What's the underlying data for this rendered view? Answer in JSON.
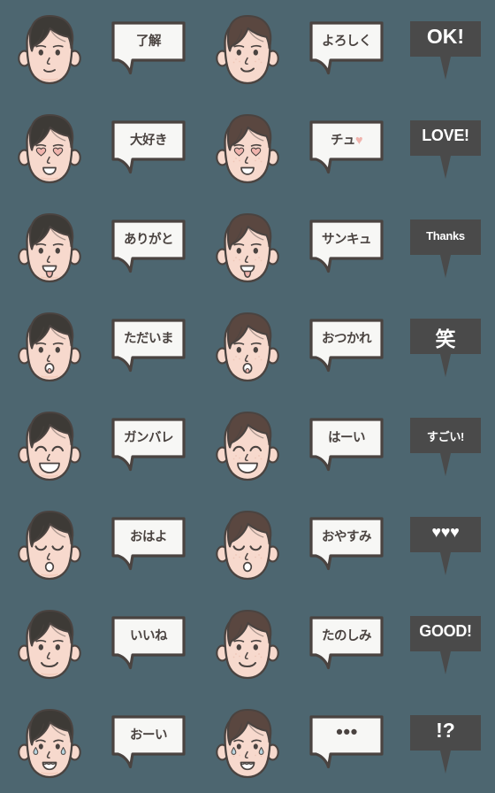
{
  "sheet": {
    "title": "Emoji sticker sheet",
    "background_color": "#4d6670",
    "columns": 5,
    "rows": 8,
    "colors": {
      "background": "#4d6670",
      "bubble_white_fill": "#f7f7f5",
      "bubble_white_border": "#4a4340",
      "bubble_dark_fill": "#4a4a4a",
      "bubble_text_dark": "#4a4340",
      "bubble_text_light": "#ffffff",
      "hair_dark": "#3d3a36",
      "hair_brown": "#5a4740",
      "skin": "#f7d9cd",
      "skin_shadow": "#efc6b6",
      "outline": "#4a4340",
      "heart_pink": "#f0b4ad",
      "heart_white": "#ffffff",
      "tear": "#b8d4de"
    }
  },
  "items": [
    {
      "col": 1,
      "row": 1,
      "kind": "face",
      "name": "face-neutral-smile-dark-hair",
      "hair": "dark",
      "expression": "neutral-smile"
    },
    {
      "col": 2,
      "row": 1,
      "kind": "bubble-white",
      "name": "bubble-ryoukai",
      "text": "了解",
      "size": "jp"
    },
    {
      "col": 3,
      "row": 1,
      "kind": "face",
      "name": "face-smile-brown-hair",
      "hair": "brown",
      "expression": "smile"
    },
    {
      "col": 4,
      "row": 1,
      "kind": "bubble-white",
      "name": "bubble-yoroshiku",
      "text": "よろしく",
      "size": "jp"
    },
    {
      "col": 5,
      "row": 1,
      "kind": "bubble-dark",
      "name": "bubble-ok",
      "text": "OK!",
      "size": "big"
    },
    {
      "col": 1,
      "row": 2,
      "kind": "face",
      "name": "face-heart-eyes-dark-hair",
      "hair": "dark",
      "expression": "heart-eyes"
    },
    {
      "col": 2,
      "row": 2,
      "kind": "bubble-white",
      "name": "bubble-daisuki",
      "text": "大好き",
      "size": "jp"
    },
    {
      "col": 3,
      "row": 2,
      "kind": "face",
      "name": "face-heart-eyes-brown-hair",
      "hair": "brown",
      "expression": "heart-eyes"
    },
    {
      "col": 4,
      "row": 2,
      "kind": "bubble-white",
      "name": "bubble-chu-heart",
      "text": "チュ♡",
      "size": "jp",
      "heart_suffix": true
    },
    {
      "col": 5,
      "row": 2,
      "kind": "bubble-dark",
      "name": "bubble-love",
      "text": "LOVE!",
      "size": "med"
    },
    {
      "col": 1,
      "row": 3,
      "kind": "face",
      "name": "face-tongue-out-dark-hair",
      "hair": "dark",
      "expression": "tongue-out"
    },
    {
      "col": 2,
      "row": 3,
      "kind": "bubble-white",
      "name": "bubble-arigato",
      "text": "ありがと",
      "size": "jp"
    },
    {
      "col": 3,
      "row": 3,
      "kind": "face",
      "name": "face-tongue-out-brown-hair",
      "hair": "brown",
      "expression": "tongue-out"
    },
    {
      "col": 4,
      "row": 3,
      "kind": "bubble-white",
      "name": "bubble-sankyu",
      "text": "サンキュ",
      "size": "jp"
    },
    {
      "col": 5,
      "row": 3,
      "kind": "bubble-dark",
      "name": "bubble-thanks",
      "text": "Thanks",
      "size": "small"
    },
    {
      "col": 1,
      "row": 4,
      "kind": "face",
      "name": "face-whistle-dark-hair",
      "hair": "dark",
      "expression": "whistle"
    },
    {
      "col": 2,
      "row": 4,
      "kind": "bubble-white",
      "name": "bubble-tadaima",
      "text": "ただいま",
      "size": "jp"
    },
    {
      "col": 3,
      "row": 4,
      "kind": "face",
      "name": "face-whistle-brown-hair",
      "hair": "brown",
      "expression": "whistle"
    },
    {
      "col": 4,
      "row": 4,
      "kind": "bubble-white",
      "name": "bubble-otsukare",
      "text": "おつかれ",
      "size": "jp"
    },
    {
      "col": 5,
      "row": 4,
      "kind": "bubble-dark",
      "name": "bubble-warai",
      "text": "笑",
      "size": "big"
    },
    {
      "col": 1,
      "row": 5,
      "kind": "face",
      "name": "face-big-grin-dark-hair",
      "hair": "dark",
      "expression": "big-grin"
    },
    {
      "col": 2,
      "row": 5,
      "kind": "bubble-white",
      "name": "bubble-ganbare",
      "text": "ガンバレ",
      "size": "jp"
    },
    {
      "col": 3,
      "row": 5,
      "kind": "face",
      "name": "face-big-grin-brown-hair",
      "hair": "brown",
      "expression": "big-grin"
    },
    {
      "col": 4,
      "row": 5,
      "kind": "bubble-white",
      "name": "bubble-haai",
      "text": "はーい",
      "size": "jp"
    },
    {
      "col": 5,
      "row": 5,
      "kind": "bubble-dark",
      "name": "bubble-sugoi",
      "text": "すごい!",
      "size": "small"
    },
    {
      "col": 1,
      "row": 6,
      "kind": "face",
      "name": "face-sleepy-dark-hair",
      "hair": "dark",
      "expression": "sleepy"
    },
    {
      "col": 2,
      "row": 6,
      "kind": "bubble-white",
      "name": "bubble-ohayo",
      "text": "おはよ",
      "size": "jp"
    },
    {
      "col": 3,
      "row": 6,
      "kind": "face",
      "name": "face-sleepy-brown-hair",
      "hair": "brown",
      "expression": "sleepy"
    },
    {
      "col": 4,
      "row": 6,
      "kind": "bubble-white",
      "name": "bubble-oyasumi",
      "text": "おやすみ",
      "size": "jp"
    },
    {
      "col": 5,
      "row": 6,
      "kind": "bubble-dark",
      "name": "bubble-three-hearts",
      "text": "♥♥♥",
      "size": "med"
    },
    {
      "col": 1,
      "row": 7,
      "kind": "face",
      "name": "face-content-dark-hair",
      "hair": "dark",
      "expression": "content"
    },
    {
      "col": 2,
      "row": 7,
      "kind": "bubble-white",
      "name": "bubble-iine",
      "text": "いいね",
      "size": "jp"
    },
    {
      "col": 3,
      "row": 7,
      "kind": "face",
      "name": "face-content-brown-hair",
      "hair": "brown",
      "expression": "content"
    },
    {
      "col": 4,
      "row": 7,
      "kind": "bubble-white",
      "name": "bubble-tanoshimi",
      "text": "たのしみ",
      "size": "jp"
    },
    {
      "col": 5,
      "row": 7,
      "kind": "bubble-dark",
      "name": "bubble-good",
      "text": "GOOD!",
      "size": "med"
    },
    {
      "col": 1,
      "row": 8,
      "kind": "face",
      "name": "face-worried-dark-hair",
      "hair": "dark",
      "expression": "worried"
    },
    {
      "col": 2,
      "row": 8,
      "kind": "bubble-white",
      "name": "bubble-ooi",
      "text": "おーい",
      "size": "jp"
    },
    {
      "col": 3,
      "row": 8,
      "kind": "face",
      "name": "face-worried-brown-hair",
      "hair": "brown",
      "expression": "worried"
    },
    {
      "col": 4,
      "row": 8,
      "kind": "bubble-white",
      "name": "bubble-ellipsis",
      "text": "●●●",
      "size": "jp",
      "dots": true
    },
    {
      "col": 5,
      "row": 8,
      "kind": "bubble-dark",
      "name": "bubble-interrobang",
      "text": "!?",
      "size": "big"
    }
  ]
}
